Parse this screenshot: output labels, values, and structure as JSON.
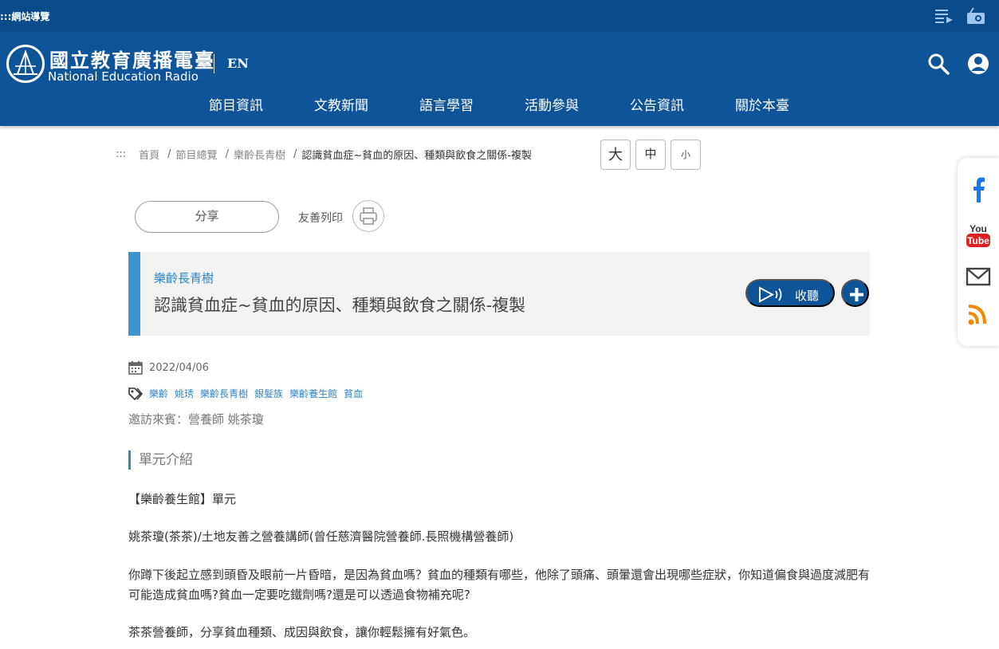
{
  "topbar": {
    "sitemap_label": ":::網站導覽"
  },
  "header": {
    "logo_zh": "國立教育廣播電臺",
    "logo_en": "National Education Radio",
    "lang_label": "EN"
  },
  "nav": [
    "節目資訊",
    "文教新聞",
    "語言學習",
    "活動參與",
    "公告資訊",
    "關於本臺"
  ],
  "breadcrumb": {
    "anchor": ":::",
    "items": [
      "首頁",
      "節目總覽",
      "樂齡長青樹",
      "認識貧血症~貧血的原因、種類與飲食之關係-複製"
    ]
  },
  "fontsize": {
    "large": "大",
    "medium": "中",
    "small": "小"
  },
  "actions": {
    "share_label": "分享",
    "print_label": "友善列印"
  },
  "program": {
    "category": "樂齡長青樹",
    "title": "認識貧血症~貧血的原因、種類與飲食之關係-複製",
    "listen_label": "收聽"
  },
  "meta": {
    "date": "2022/04/06",
    "tags": [
      "樂齡",
      "姚琇",
      "樂齡長青樹",
      "銀髮族",
      "樂齡養生館",
      "貧血"
    ],
    "guest": "邀訪來賓：營養師 姚茶瓊"
  },
  "section": {
    "heading": "單元介紹"
  },
  "content": {
    "p1": "【樂齡養生館】單元",
    "p2": "姚茶瓊(茶茶)/土地友善之營養講師(曾任慈濟醫院營養師.長照機構營養師)",
    "p3": "你蹲下後起立感到頭昏及眼前一片昏暗，是因為貧血嗎？貧血的種類有哪些，他除了頭痛、頭暈還會出現哪些症狀，你知道偏食與過度減肥有可能造成貧血嗎?貧血一定要吃鐵劑嗎?還是可以透過食物補充呢?",
    "p4": "茶茶營養師，分享貧血種類、成因與飲食，讓你輕鬆擁有好氣色。"
  },
  "colors": {
    "brand_dark": "#0a4b8c",
    "brand": "#0e5499",
    "accent": "#3a95d1",
    "link": "#2f86c8"
  },
  "icons": [
    "playlist-icon",
    "radio-icon",
    "search-icon",
    "user-icon",
    "print-icon",
    "play-icon",
    "plus-icon",
    "calendar-icon",
    "tag-icon",
    "facebook-icon",
    "youtube-icon",
    "mail-icon",
    "rss-icon"
  ]
}
